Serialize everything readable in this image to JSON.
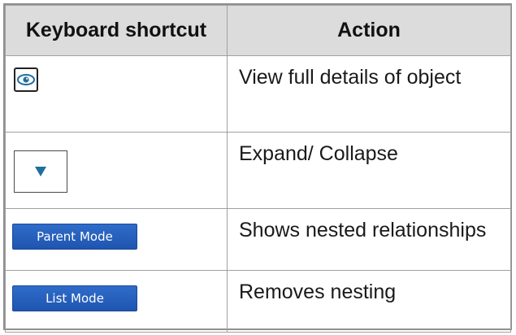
{
  "table": {
    "headers": {
      "shortcut": "Keyboard shortcut",
      "action": "Action"
    },
    "rows": [
      {
        "icon": "eye-icon",
        "action": "View full details of object"
      },
      {
        "icon": "triangle-down-icon",
        "action": "Expand/ Collapse"
      },
      {
        "button_label": "Parent Mode",
        "action": "Shows nested relationships"
      },
      {
        "button_label": "List Mode",
        "action": "Removes nesting"
      }
    ]
  },
  "colors": {
    "header_bg": "#dcdcdc",
    "button_blue": "#2a63c0",
    "icon_teal": "#1f6f9f"
  }
}
